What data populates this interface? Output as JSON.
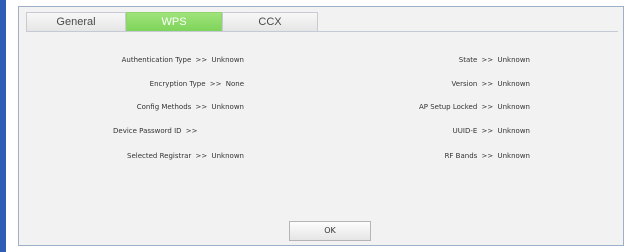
{
  "tabs": [
    {
      "label": "General"
    },
    {
      "label": "WPS"
    },
    {
      "label": "CCX"
    }
  ],
  "left_fields": [
    {
      "label": "Authentication Type",
      "separator": ">>",
      "value": "Unknown"
    },
    {
      "label": "Encryption Type",
      "separator": ">>",
      "value": "None"
    },
    {
      "label": "Config Methods",
      "separator": ">>",
      "value": "Unknown"
    },
    {
      "label": "Device Password ID",
      "separator": ">>",
      "value": ""
    },
    {
      "label": "Selected Registrar",
      "separator": ">>",
      "value": "Unknown"
    }
  ],
  "right_fields": [
    {
      "label": "State",
      "separator": ">>",
      "value": "Unknown"
    },
    {
      "label": "Version",
      "separator": ">>",
      "value": "Unknown"
    },
    {
      "label": "AP Setup Locked",
      "separator": ">>",
      "value": "Unknown"
    },
    {
      "label": "UUID-E",
      "separator": ">>",
      "value": "Unknown"
    },
    {
      "label": "RF Bands",
      "separator": ">>",
      "value": "Unknown"
    }
  ],
  "ok_label": "OK"
}
